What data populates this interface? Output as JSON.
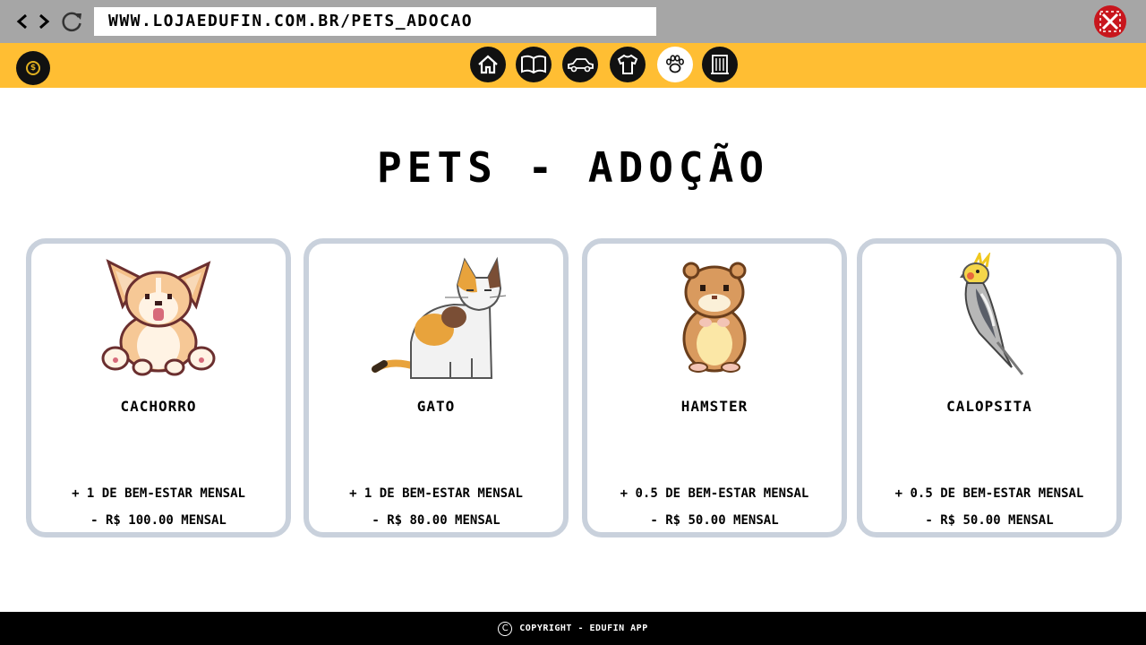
{
  "browser": {
    "url": "WWW.LOJAEDUFIN.COM.BR/PETS_ADOCAO",
    "back_icon": "chevron-left-icon",
    "forward_icon": "chevron-right-icon",
    "reload_icon": "reload-icon",
    "close_icon": "close-icon",
    "close_color": "#c8161d"
  },
  "appbar": {
    "color": "#ffbe33",
    "logo_symbol": "$",
    "nav": [
      {
        "name": "home",
        "icon": "home-icon"
      },
      {
        "name": "books",
        "icon": "book-icon"
      },
      {
        "name": "cars",
        "icon": "car-icon"
      },
      {
        "name": "clothes",
        "icon": "shirt-icon"
      },
      {
        "name": "pets",
        "icon": "paw-icon",
        "active": true
      },
      {
        "name": "buildings",
        "icon": "building-icon"
      }
    ]
  },
  "page": {
    "title": "PETS - ADOÇÃO"
  },
  "pets": [
    {
      "name": "CACHORRO",
      "benefit": "+ 1 DE BEM-ESTAR MENSAL",
      "cost": "- R$ 100.00 MENSAL",
      "icon": "dog-icon"
    },
    {
      "name": "GATO",
      "benefit": "+ 1 DE BEM-ESTAR MENSAL",
      "cost": "- R$ 80.00 MENSAL",
      "icon": "cat-icon"
    },
    {
      "name": "HAMSTER",
      "benefit": "+ 0.5 DE BEM-ESTAR MENSAL",
      "cost": "- R$ 50.00 MENSAL",
      "icon": "hamster-icon"
    },
    {
      "name": "CALOPSITA",
      "benefit": "+ 0.5 DE BEM-ESTAR MENSAL",
      "cost": "- R$ 50.00 MENSAL",
      "icon": "cockatiel-icon"
    }
  ],
  "footer": {
    "symbol": "C",
    "text": "COPYRIGHT - EDUFIN APP"
  }
}
